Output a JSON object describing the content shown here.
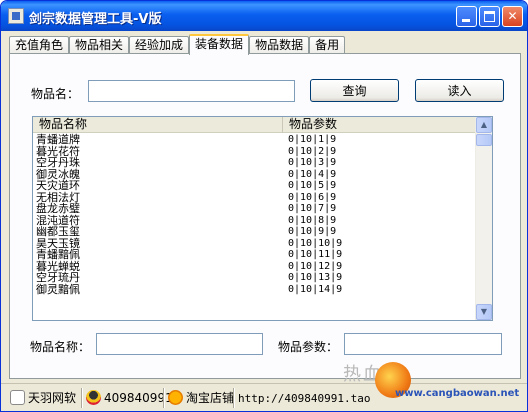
{
  "window": {
    "title": "剑宗数据管理工具-V版",
    "controls": {
      "minimize": "",
      "maximize": "",
      "close": "✕"
    }
  },
  "tabs": [
    {
      "label": "充值角色",
      "active": false
    },
    {
      "label": "物品相关",
      "active": false
    },
    {
      "label": "经验加成",
      "active": false
    },
    {
      "label": "装备数据",
      "active": true
    },
    {
      "label": "物品数据",
      "active": false
    },
    {
      "label": "备用",
      "active": false
    }
  ],
  "search": {
    "label": "物品名：",
    "value": "",
    "query_button": "查询",
    "load_button": "读入"
  },
  "list": {
    "columns": [
      "物品名称",
      "物品参数"
    ],
    "rows": [
      {
        "name": "青蟠道牌",
        "param": "0|10|1|9"
      },
      {
        "name": "暮光花符",
        "param": "0|10|2|9"
      },
      {
        "name": "空牙丹珠",
        "param": "0|10|3|9"
      },
      {
        "name": "御灵冰魄",
        "param": "0|10|4|9"
      },
      {
        "name": "天灾道环",
        "param": "0|10|5|9"
      },
      {
        "name": "无相法灯",
        "param": "0|10|6|9"
      },
      {
        "name": "盘龙赤璧",
        "param": "0|10|7|9"
      },
      {
        "name": "混沌道符",
        "param": "0|10|8|9"
      },
      {
        "name": "幽都玉玺",
        "param": "0|10|9|9"
      },
      {
        "name": "昊天玉镜",
        "param": "0|10|10|9"
      },
      {
        "name": "青蟠黯佩",
        "param": "0|10|11|9"
      },
      {
        "name": "暮光蝉蜕",
        "param": "0|10|12|9"
      },
      {
        "name": "空牙琉丹",
        "param": "0|10|13|9"
      },
      {
        "name": "御灵黯佩",
        "param": "0|10|14|9"
      }
    ],
    "scroll_up": "▲",
    "scroll_down": "▼"
  },
  "fields": {
    "name_label": "物品名称：",
    "name_value": "",
    "param_label": "物品参数：",
    "param_value": ""
  },
  "statusbar": {
    "brand": "天羽网软",
    "qq": "409840991",
    "shop": "淘宝店铺",
    "url": "http://409840991.tao"
  },
  "watermark": {
    "text": "热血",
    "url": "www.cangbaowan.net"
  },
  "colors": {
    "titlebar": "#0a5ff0",
    "window_bg": "#ece9d8",
    "tab_active_accent": "#ffc83c",
    "input_border": "#7f9db9"
  }
}
